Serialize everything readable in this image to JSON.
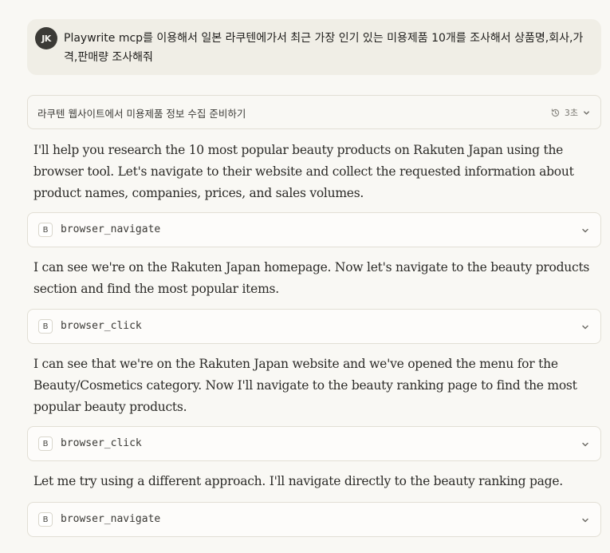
{
  "user_message": {
    "avatar_initials": "JK",
    "text": "Playwrite mcp를 이용해서 일본 라쿠텐에가서 최근 가장 인기 있는 미용제품 10개를 조사해서 상품명,회사,가격,판매량 조사해줘"
  },
  "thinking": {
    "title": "라쿠텐 웹사이트에서 미용제품 정보 수집 준비하기",
    "duration": "3초",
    "icon": "clock-rewind-icon"
  },
  "messages": [
    {
      "type": "text",
      "text": "I'll help you research the 10 most popular beauty products on Rakuten Japan using the browser tool. Let's navigate to their website and collect the requested information about product names, companies, prices, and sales volumes."
    },
    {
      "type": "tool",
      "badge": "B",
      "name": "browser_navigate"
    },
    {
      "type": "text",
      "text": "I can see we're on the Rakuten Japan homepage. Now let's navigate to the beauty products section and find the most popular items."
    },
    {
      "type": "tool",
      "badge": "B",
      "name": "browser_click"
    },
    {
      "type": "text",
      "text": "I can see that we're on the Rakuten Japan website and we've opened the menu for the Beauty/Cosmetics category. Now I'll navigate to the beauty ranking page to find the most popular beauty products."
    },
    {
      "type": "tool",
      "badge": "B",
      "name": "browser_click"
    },
    {
      "type": "text",
      "text": "Let me try using a different approach. I'll navigate directly to the beauty ranking page."
    },
    {
      "type": "tool",
      "badge": "B",
      "name": "browser_navigate"
    }
  ],
  "colors": {
    "background": "#f9f8f4",
    "user_bubble": "#f0eee6",
    "border": "#e2dfd5",
    "avatar": "#3b3a36"
  }
}
